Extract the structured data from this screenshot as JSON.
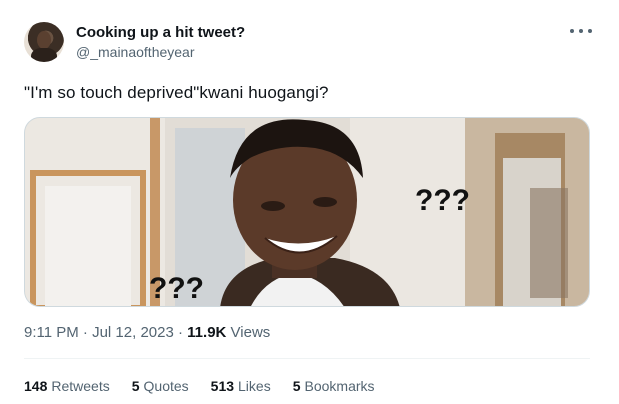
{
  "author": {
    "display_name": "Cooking up a hit tweet?",
    "handle": "@_mainaoftheyear",
    "avatar_icon": "profile-photo"
  },
  "tweet": {
    "text": "\"I'm so touch deprived\"kwani huogangi?",
    "image_captions": [
      "???",
      "???"
    ]
  },
  "meta": {
    "time": "9:11 PM",
    "separator": "·",
    "date": "Jul 12, 2023",
    "views_count": "11.9K",
    "views_label": "Views"
  },
  "stats": [
    {
      "count": "148",
      "label": "Retweets"
    },
    {
      "count": "5",
      "label": "Quotes"
    },
    {
      "count": "513",
      "label": "Likes"
    },
    {
      "count": "5",
      "label": "Bookmarks"
    }
  ],
  "colors": {
    "text_primary": "#0f1419",
    "text_secondary": "#536471",
    "divider": "#eff3f4"
  }
}
